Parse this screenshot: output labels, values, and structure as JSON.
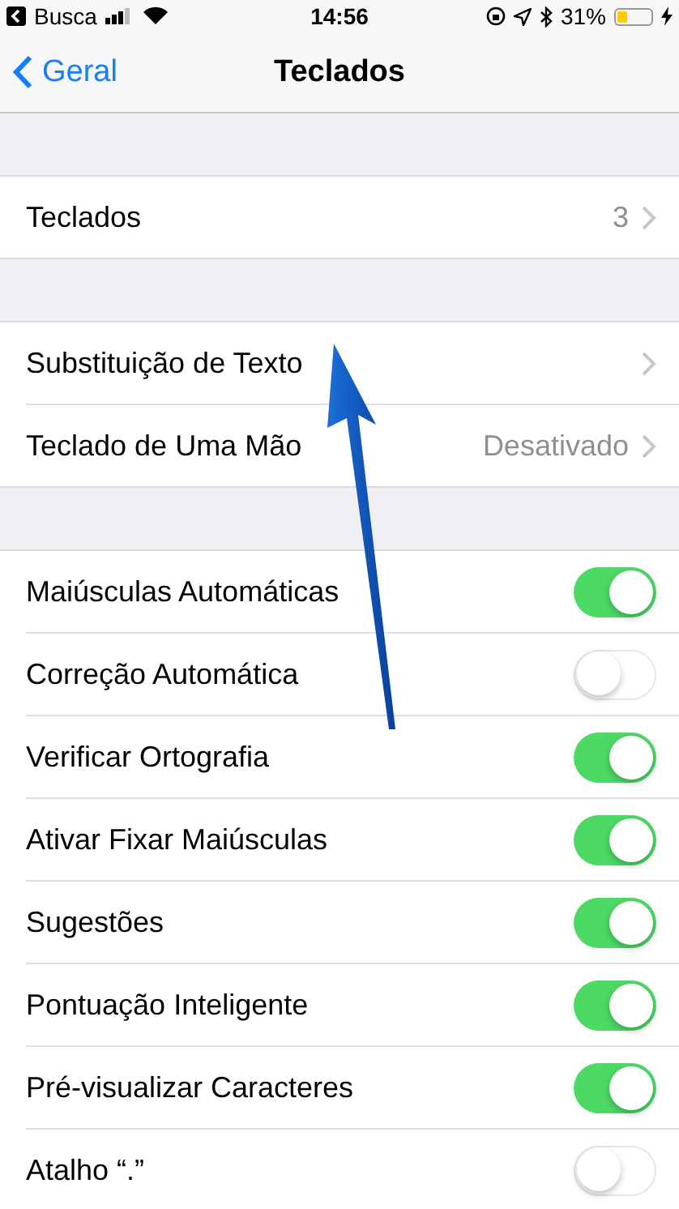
{
  "status_bar": {
    "back_app": "Busca",
    "time": "14:56",
    "battery_percent": "31%",
    "charging": true
  },
  "nav": {
    "back": "Geral",
    "title": "Teclados"
  },
  "sections": [
    {
      "rows": [
        {
          "kind": "link",
          "label": "Teclados",
          "value": "3"
        }
      ]
    },
    {
      "rows": [
        {
          "kind": "link",
          "label": "Substituição de Texto"
        },
        {
          "kind": "link",
          "label": "Teclado de Uma Mão",
          "value": "Desativado"
        }
      ]
    },
    {
      "rows": [
        {
          "kind": "toggle",
          "label": "Maiúsculas Automáticas",
          "on": true
        },
        {
          "kind": "toggle",
          "label": "Correção Automática",
          "on": false
        },
        {
          "kind": "toggle",
          "label": "Verificar Ortografia",
          "on": true
        },
        {
          "kind": "toggle",
          "label": "Ativar Fixar Maiúsculas",
          "on": true
        },
        {
          "kind": "toggle",
          "label": "Sugestões",
          "on": true
        },
        {
          "kind": "toggle",
          "label": "Pontuação Inteligente",
          "on": true
        },
        {
          "kind": "toggle",
          "label": "Pré-visualizar Caracteres",
          "on": true
        },
        {
          "kind": "toggle",
          "label": "Atalho “.”",
          "on": false
        }
      ]
    }
  ]
}
